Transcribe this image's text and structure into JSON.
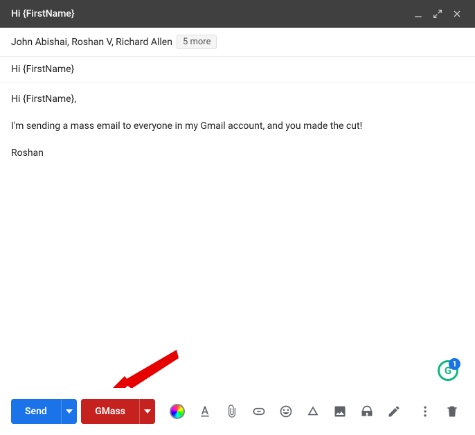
{
  "header": {
    "title": "Hi {FirstName}"
  },
  "recipients": {
    "list": "John Abishai, Roshan V, Richard Allen",
    "more": "5 more"
  },
  "subject": "Hi {FirstName}",
  "body": {
    "line1": "Hi {FirstName},",
    "line2": "I'm sending a mass email to everyone in my Gmail account, and you made the cut!",
    "line3": "Roshan"
  },
  "grammarly": {
    "letter": "G",
    "count": "1"
  },
  "toolbar": {
    "send": "Send",
    "gmass": "GMass"
  }
}
